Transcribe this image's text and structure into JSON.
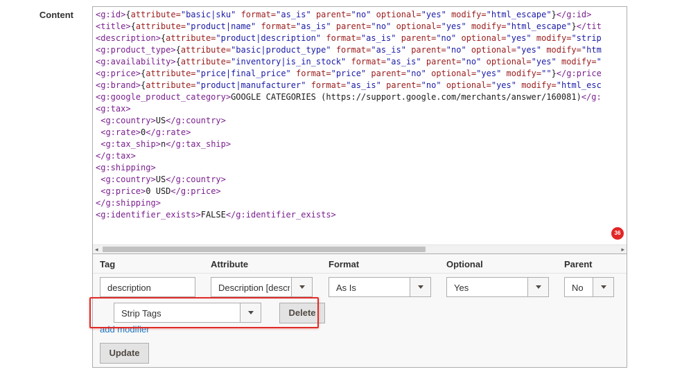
{
  "field": {
    "label": "Content"
  },
  "editor": {
    "lines": [
      [
        [
          "tg",
          "<g:id>"
        ],
        [
          "tx",
          "{"
        ],
        [
          "an",
          "attribute="
        ],
        [
          "av",
          "\"basic|sku\""
        ],
        [
          "tx",
          " "
        ],
        [
          "an",
          "format="
        ],
        [
          "av",
          "\"as_is\""
        ],
        [
          "tx",
          " "
        ],
        [
          "an",
          "parent="
        ],
        [
          "av",
          "\"no\""
        ],
        [
          "tx",
          " "
        ],
        [
          "an",
          "optional="
        ],
        [
          "av",
          "\"yes\""
        ],
        [
          "tx",
          " "
        ],
        [
          "an",
          "modify="
        ],
        [
          "av",
          "\"html_escape\""
        ],
        [
          "tx",
          "}"
        ],
        [
          "tg",
          "</g:id>"
        ]
      ],
      [
        [
          "tg",
          "<title>"
        ],
        [
          "tx",
          "{"
        ],
        [
          "an",
          "attribute="
        ],
        [
          "av",
          "\"product|name\""
        ],
        [
          "tx",
          " "
        ],
        [
          "an",
          "format="
        ],
        [
          "av",
          "\"as_is\""
        ],
        [
          "tx",
          " "
        ],
        [
          "an",
          "parent="
        ],
        [
          "av",
          "\"no\""
        ],
        [
          "tx",
          " "
        ],
        [
          "an",
          "optional="
        ],
        [
          "av",
          "\"yes\""
        ],
        [
          "tx",
          " "
        ],
        [
          "an",
          "modify="
        ],
        [
          "av",
          "\"html_escape\""
        ],
        [
          "tx",
          "}"
        ],
        [
          "tg",
          "</tit"
        ]
      ],
      [
        [
          "tg",
          "<description>"
        ],
        [
          "tx",
          "{"
        ],
        [
          "an",
          "attribute="
        ],
        [
          "av",
          "\"product|description\""
        ],
        [
          "tx",
          " "
        ],
        [
          "an",
          "format="
        ],
        [
          "av",
          "\"as_is\""
        ],
        [
          "tx",
          " "
        ],
        [
          "an",
          "parent="
        ],
        [
          "av",
          "\"no\""
        ],
        [
          "tx",
          " "
        ],
        [
          "an",
          "optional="
        ],
        [
          "av",
          "\"yes\""
        ],
        [
          "tx",
          " "
        ],
        [
          "an",
          "modify="
        ],
        [
          "av",
          "\"strip"
        ]
      ],
      [
        [
          "tg",
          "<g:product_type>"
        ],
        [
          "tx",
          "{"
        ],
        [
          "an",
          "attribute="
        ],
        [
          "av",
          "\"basic|product_type\""
        ],
        [
          "tx",
          " "
        ],
        [
          "an",
          "format="
        ],
        [
          "av",
          "\"as_is\""
        ],
        [
          "tx",
          " "
        ],
        [
          "an",
          "parent="
        ],
        [
          "av",
          "\"no\""
        ],
        [
          "tx",
          " "
        ],
        [
          "an",
          "optional="
        ],
        [
          "av",
          "\"yes\""
        ],
        [
          "tx",
          " "
        ],
        [
          "an",
          "modify="
        ],
        [
          "av",
          "\"htm"
        ]
      ],
      [
        [
          "tg",
          "<g:availability>"
        ],
        [
          "tx",
          "{"
        ],
        [
          "an",
          "attribute="
        ],
        [
          "av",
          "\"inventory|is_in_stock\""
        ],
        [
          "tx",
          " "
        ],
        [
          "an",
          "format="
        ],
        [
          "av",
          "\"as_is\""
        ],
        [
          "tx",
          " "
        ],
        [
          "an",
          "parent="
        ],
        [
          "av",
          "\"no\""
        ],
        [
          "tx",
          " "
        ],
        [
          "an",
          "optional="
        ],
        [
          "av",
          "\"yes\""
        ],
        [
          "tx",
          " "
        ],
        [
          "an",
          "modify="
        ],
        [
          "av",
          "\""
        ]
      ],
      [
        [
          "tg",
          "<g:price>"
        ],
        [
          "tx",
          "{"
        ],
        [
          "an",
          "attribute="
        ],
        [
          "av",
          "\"price|final_price\""
        ],
        [
          "tx",
          " "
        ],
        [
          "an",
          "format="
        ],
        [
          "av",
          "\"price\""
        ],
        [
          "tx",
          " "
        ],
        [
          "an",
          "parent="
        ],
        [
          "av",
          "\"no\""
        ],
        [
          "tx",
          " "
        ],
        [
          "an",
          "optional="
        ],
        [
          "av",
          "\"yes\""
        ],
        [
          "tx",
          " "
        ],
        [
          "an",
          "modify="
        ],
        [
          "av",
          "\"\""
        ],
        [
          "tx",
          "}"
        ],
        [
          "tg",
          "</g:price"
        ]
      ],
      [
        [
          "tg",
          "<g:brand>"
        ],
        [
          "tx",
          "{"
        ],
        [
          "an",
          "attribute="
        ],
        [
          "av",
          "\"product|manufacturer\""
        ],
        [
          "tx",
          " "
        ],
        [
          "an",
          "format="
        ],
        [
          "av",
          "\"as_is\""
        ],
        [
          "tx",
          " "
        ],
        [
          "an",
          "parent="
        ],
        [
          "av",
          "\"no\""
        ],
        [
          "tx",
          " "
        ],
        [
          "an",
          "optional="
        ],
        [
          "av",
          "\"yes\""
        ],
        [
          "tx",
          " "
        ],
        [
          "an",
          "modify="
        ],
        [
          "av",
          "\"html_esc"
        ]
      ],
      [
        [
          "tg",
          "<g:google_product_category>"
        ],
        [
          "tx",
          "GOOGLE CATEGORIES (https://support.google.com/merchants/answer/160081)"
        ],
        [
          "tg",
          "</g:"
        ]
      ],
      [
        [
          "tg",
          "<g:tax>"
        ]
      ],
      [
        [
          "tx",
          " "
        ],
        [
          "tg",
          "<g:country>"
        ],
        [
          "tx",
          "US"
        ],
        [
          "tg",
          "</g:country>"
        ]
      ],
      [
        [
          "tx",
          " "
        ],
        [
          "tg",
          "<g:rate>"
        ],
        [
          "tx",
          "0"
        ],
        [
          "tg",
          "</g:rate>"
        ]
      ],
      [
        [
          "tx",
          " "
        ],
        [
          "tg",
          "<g:tax_ship>"
        ],
        [
          "tx",
          "n"
        ],
        [
          "tg",
          "</g:tax_ship>"
        ]
      ],
      [
        [
          "tg",
          "</g:tax>"
        ]
      ],
      [
        [
          "tg",
          "<g:shipping>"
        ]
      ],
      [
        [
          "tx",
          " "
        ],
        [
          "tg",
          "<g:country>"
        ],
        [
          "tx",
          "US"
        ],
        [
          "tg",
          "</g:country>"
        ]
      ],
      [
        [
          "tx",
          " "
        ],
        [
          "tg",
          "<g:price>"
        ],
        [
          "tx",
          "0 USD"
        ],
        [
          "tg",
          "</g:price>"
        ]
      ],
      [
        [
          "tg",
          "</g:shipping>"
        ]
      ],
      [
        [
          "tg",
          "<g:identifier_exists>"
        ],
        [
          "tx",
          "FALSE"
        ],
        [
          "tg",
          "</g:identifier_exists>"
        ]
      ]
    ],
    "badge": "36",
    "scroll_left_glyph": "◂",
    "scroll_right_glyph": "▸"
  },
  "table": {
    "headers": {
      "tag": "Tag",
      "attribute": "Attribute",
      "format": "Format",
      "optional": "Optional",
      "parent": "Parent"
    },
    "row": {
      "tag": "description",
      "attribute": "Description [description]",
      "format": "As Is",
      "optional": "Yes",
      "parent": "No"
    },
    "modifier": {
      "value": "Strip Tags",
      "delete_label": "Delete"
    },
    "add_modifier_label": "add modifier",
    "update_label": "Update"
  },
  "colors": {
    "tag": "#7a1f8f",
    "attr_name": "#9b1b1b",
    "attr_value": "#1a1aa6",
    "highlight": "#e02b27",
    "badge": "#e22626",
    "link": "#1979c3"
  }
}
